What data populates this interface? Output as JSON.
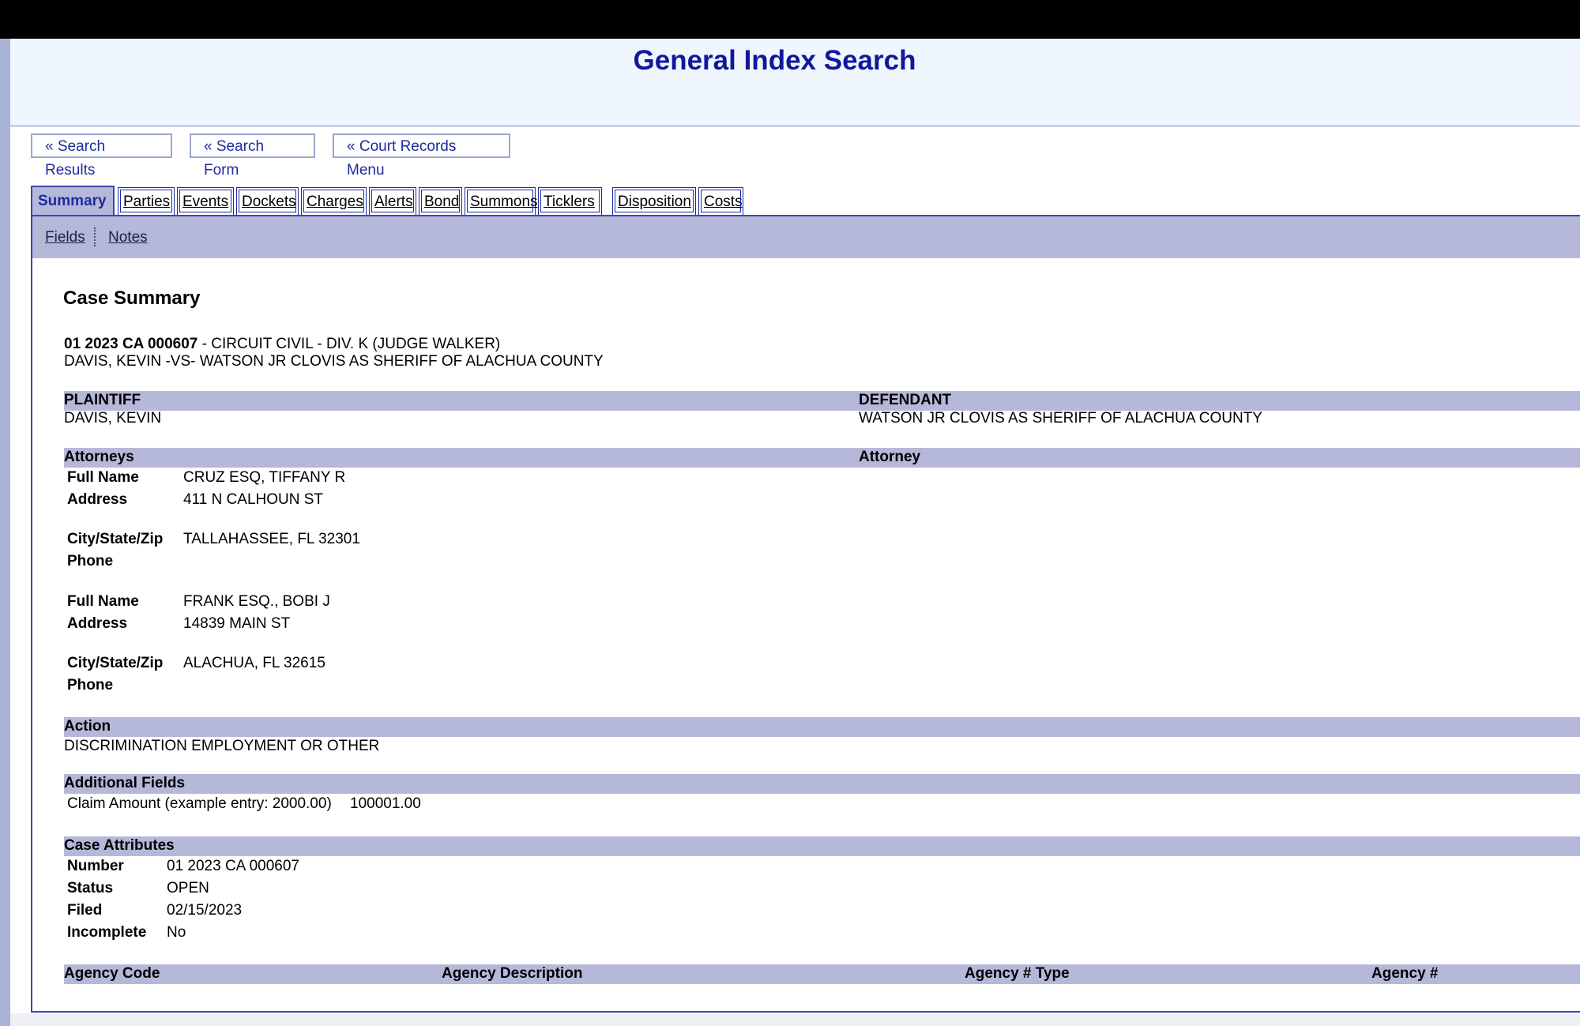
{
  "header": {
    "title": "General Index Search"
  },
  "nav": {
    "search_results": "« Search Results",
    "search_form": "« Search Form",
    "court_records_menu": "« Court Records Menu"
  },
  "tabs": {
    "summary": "Summary",
    "parties": "Parties",
    "events": "Events",
    "dockets": "Dockets",
    "charges": "Charges",
    "alerts": "Alerts",
    "bond": "Bond",
    "summons": "Summons",
    "ticklers": "Ticklers",
    "disposition": "Disposition",
    "costs": "Costs",
    "active": "Summary"
  },
  "subtabs": {
    "fields": "Fields",
    "notes": "Notes"
  },
  "case": {
    "heading": "Case Summary",
    "number_bold": "01 2023 CA 000607",
    "line1_rest": " - CIRCUIT CIVIL - DIV. K (JUDGE WALKER)",
    "line2": "DAVIS, KEVIN -VS- WATSON JR CLOVIS AS SHERIFF OF ALACHUA COUNTY"
  },
  "parties": {
    "plaintiff_label": "PLAINTIFF",
    "plaintiff_name": "DAVIS, KEVIN",
    "defendant_label": "DEFENDANT",
    "defendant_name": "WATSON JR CLOVIS AS SHERIFF OF ALACHUA COUNTY",
    "attorneys_label": "Attorneys",
    "attorney_label": "Attorney"
  },
  "attorneys": [
    {
      "full_name_label": "Full Name",
      "full_name": "CRUZ ESQ, TIFFANY R",
      "address_label": "Address",
      "address": "411 N CALHOUN ST",
      "csz_label": "City/State/Zip",
      "csz": "TALLAHASSEE, FL 32301",
      "phone_label": "Phone",
      "phone": ""
    },
    {
      "full_name_label": "Full Name",
      "full_name": "FRANK ESQ., BOBI J",
      "address_label": "Address",
      "address": "14839 MAIN ST",
      "csz_label": "City/State/Zip",
      "csz": "ALACHUA, FL 32615",
      "phone_label": "Phone",
      "phone": ""
    }
  ],
  "action": {
    "label": "Action",
    "value": "DISCRIMINATION EMPLOYMENT OR OTHER"
  },
  "additional_fields": {
    "label": "Additional Fields",
    "claim_label": "Claim Amount (example entry: 2000.00)",
    "claim_value": "100001.00"
  },
  "case_attributes": {
    "label": "Case Attributes",
    "number_label": "Number",
    "number": "01 2023 CA 000607",
    "status_label": "Status",
    "status": "OPEN",
    "filed_label": "Filed",
    "filed": "02/15/2023",
    "incomplete_label": "Incomplete",
    "incomplete": "No"
  },
  "agency_table": {
    "columns": [
      "Agency Code",
      "Agency Description",
      "Agency # Type",
      "Agency #"
    ]
  },
  "colors": {
    "title_blue": "#10189a",
    "bar_lavender": "#b6b8da",
    "header_bg": "#f0f6fd"
  }
}
